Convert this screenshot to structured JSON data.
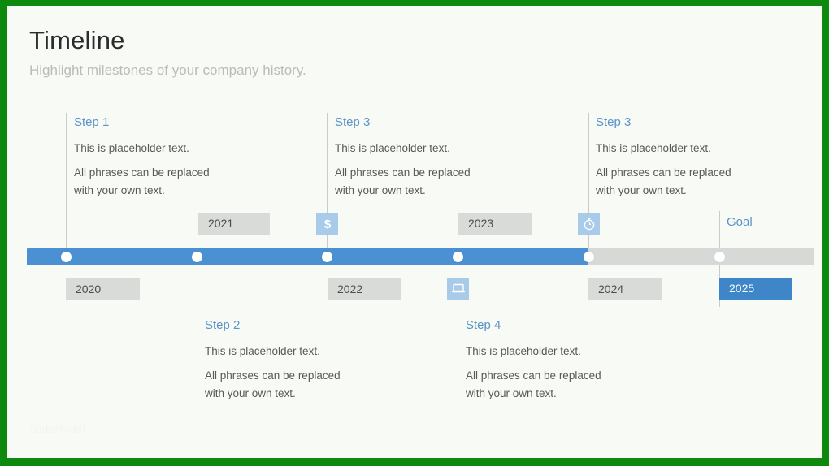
{
  "header": {
    "title": "Timeline",
    "subtitle": "Highlight milestones of your company history."
  },
  "steps": [
    {
      "id": "step-1",
      "title": "Step 1",
      "line1": "This is placeholder  text.",
      "line2": "All phrases can be replaced",
      "line3": "with your own text.",
      "position": "above"
    },
    {
      "id": "step-2",
      "title": "Step 2",
      "line1": "This is placeholder  text.",
      "line2": "All phrases can be replaced",
      "line3": "with your own text.",
      "position": "below"
    },
    {
      "id": "step-3",
      "title": "Step 3",
      "line1": "This is placeholder  text.",
      "line2": "All phrases can be replaced",
      "line3": "with your own text.",
      "position": "above"
    },
    {
      "id": "step-4",
      "title": "Step 4",
      "line1": "This is placeholder  text.",
      "line2": "All phrases can be replaced",
      "line3": "with your own text.",
      "position": "below"
    },
    {
      "id": "step-5",
      "title": "Step 3",
      "line1": "This is placeholder  text.",
      "line2": "All phrases can be replaced",
      "line3": "with your own text.",
      "position": "above"
    }
  ],
  "years": [
    {
      "label": "2020",
      "position": "below",
      "highlight": false
    },
    {
      "label": "2021",
      "position": "above",
      "highlight": false
    },
    {
      "label": "2022",
      "position": "below",
      "highlight": false
    },
    {
      "label": "2023",
      "position": "above",
      "highlight": false
    },
    {
      "label": "2024",
      "position": "below",
      "highlight": false
    },
    {
      "label": "2025",
      "position": "below",
      "highlight": true
    }
  ],
  "goal": {
    "label": "Goal"
  },
  "icons": [
    {
      "name": "dollar-icon",
      "position": "above"
    },
    {
      "name": "laptop-icon",
      "position": "below"
    },
    {
      "name": "stopwatch-icon",
      "position": "above"
    }
  ],
  "watermark": {
    "text": "SlideModel"
  },
  "colors": {
    "frame_green": "#0d8a0d",
    "canvas": "#f7faf5",
    "bar_done": "#4a90d2",
    "bar_todo": "#d7d9d7",
    "accent_blue": "#5b93c9",
    "icon_badge": "#a8cbea",
    "chip_gray": "#d9dbd8",
    "chip_highlight": "#3e86c8",
    "title_text": "#2b2b2b",
    "subtitle_text": "#b9bcb7",
    "body_text": "#595959"
  },
  "markers": {
    "count": 6
  }
}
